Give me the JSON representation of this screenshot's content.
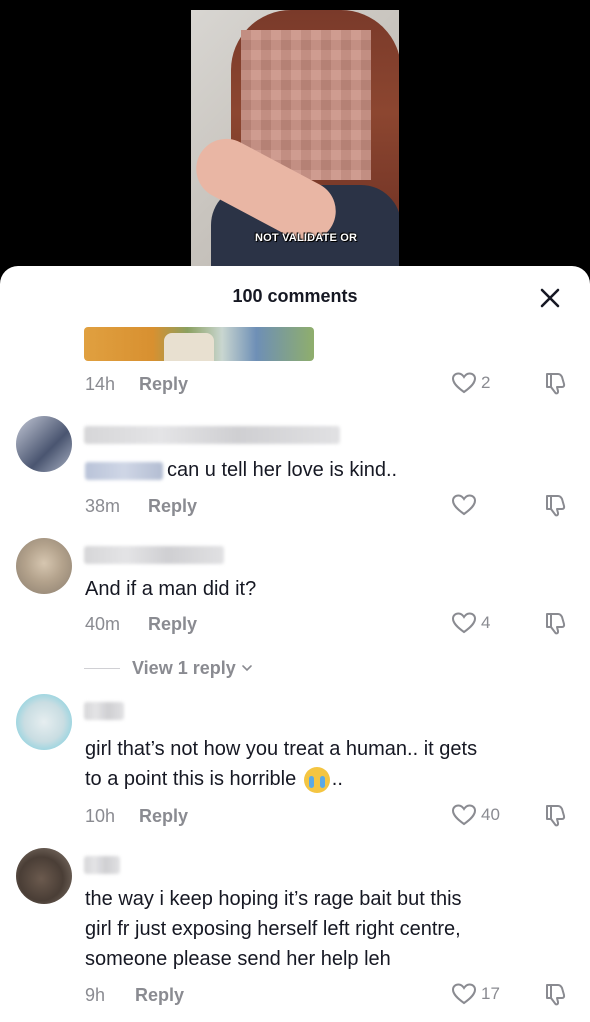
{
  "video": {
    "caption": "NOT VALIDATE OR"
  },
  "sheet": {
    "title": "100 comments",
    "close_icon": "close-icon"
  },
  "comments": [
    {
      "text": "",
      "time": "14h",
      "reply_label": "Reply",
      "likes": "2",
      "has_image": true
    },
    {
      "text": "can u tell her love is kind..",
      "time": "38m",
      "reply_label": "Reply",
      "likes": ""
    },
    {
      "text": "And if a man did it?",
      "time": "40m",
      "reply_label": "Reply",
      "likes": "4",
      "view_replies": "View 1 reply"
    },
    {
      "text_line1": "girl that’s not how you treat a human.. it gets",
      "text_line2_before": "to a point this is horrible",
      "text_line2_after": "..",
      "emoji": "loudly-crying-face",
      "time": "10h",
      "reply_label": "Reply",
      "likes": "40"
    },
    {
      "text_line1": "the way i keep hoping it’s rage bait but this",
      "text_line2": "girl fr just exposing herself left right centre,",
      "text_line3": "someone please send her help leh",
      "time": "9h",
      "reply_label": "Reply",
      "likes": "17"
    }
  ],
  "colors": {
    "text_primary": "#161823",
    "text_secondary": "#8a8b91",
    "sheet_bg": "#ffffff",
    "backdrop": "#000000"
  }
}
